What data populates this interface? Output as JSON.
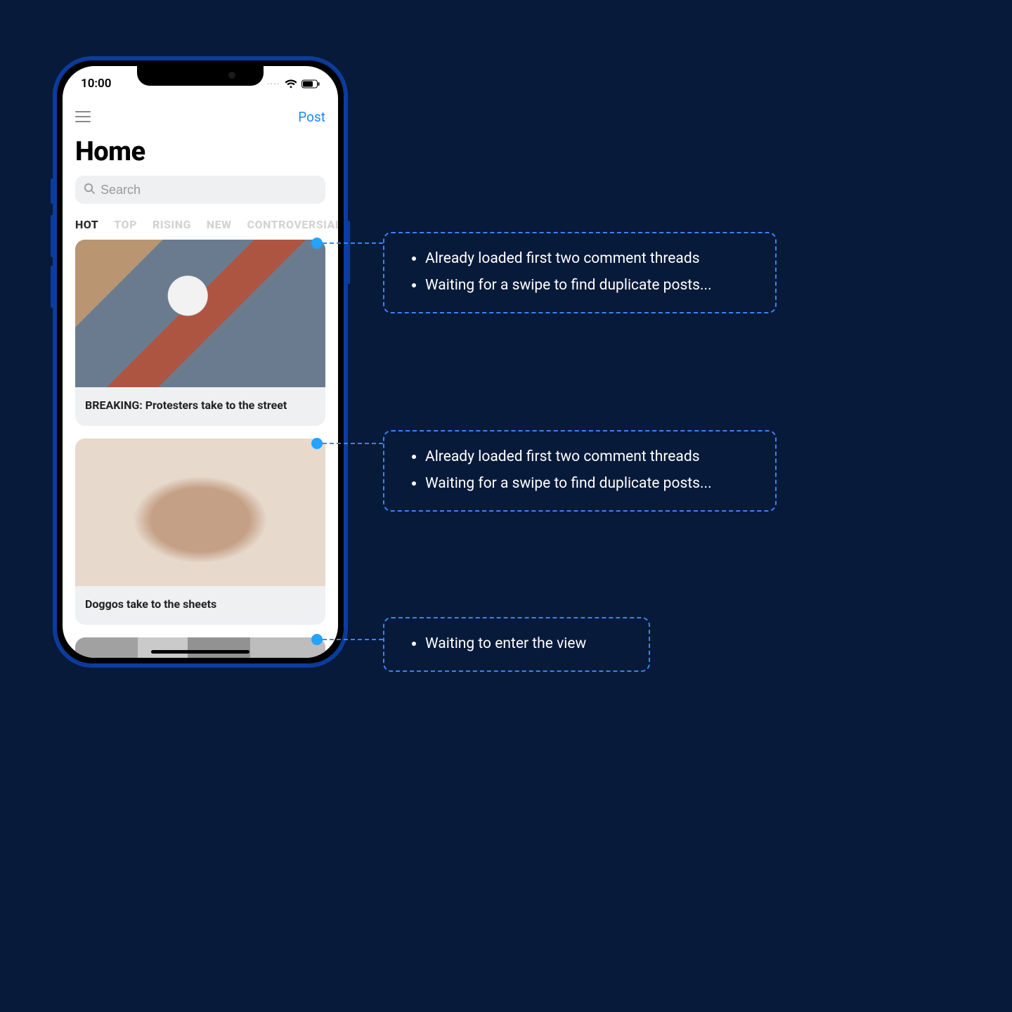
{
  "status": {
    "time": "10:00"
  },
  "navbar": {
    "post_link": "Post"
  },
  "page": {
    "title": "Home"
  },
  "search": {
    "placeholder": "Search"
  },
  "tabs": [
    {
      "label": "HOT",
      "active": true
    },
    {
      "label": "TOP",
      "active": false
    },
    {
      "label": "RISING",
      "active": false
    },
    {
      "label": "NEW",
      "active": false
    },
    {
      "label": "CONTROVERSIAL",
      "active": false
    }
  ],
  "feed": [
    {
      "title": "BREAKING: Protesters take to the street"
    },
    {
      "title": "Doggos take to the sheets"
    },
    {
      "title": ""
    }
  ],
  "callouts": [
    {
      "items": [
        "Already loaded first two comment threads",
        "Waiting for a swipe to find duplicate posts..."
      ]
    },
    {
      "items": [
        "Already loaded first two comment threads",
        "Waiting for a swipe to find duplicate posts..."
      ]
    },
    {
      "items": [
        "Waiting to enter the view"
      ]
    }
  ]
}
